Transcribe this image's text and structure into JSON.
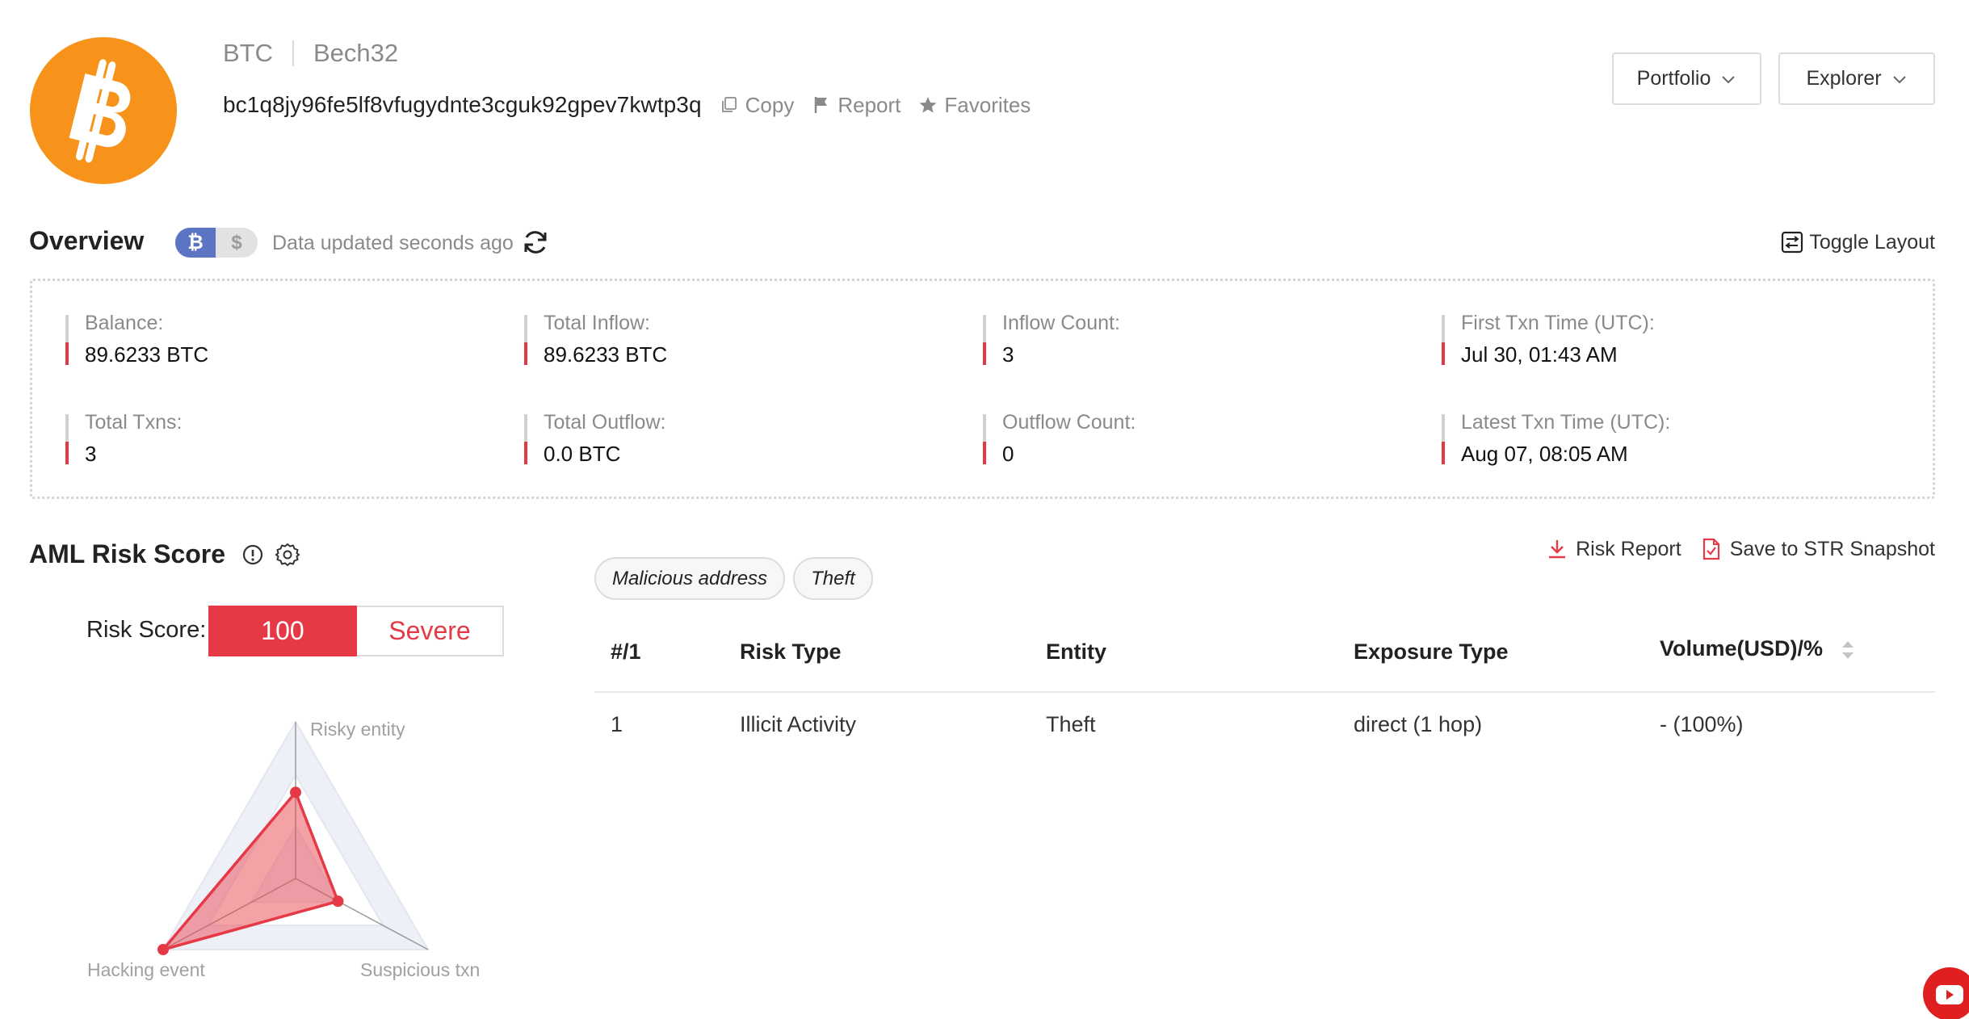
{
  "header": {
    "coin": "BTC",
    "address_type": "Bech32",
    "address": "bc1q8jy96fe5lf8vfugydnte3cguk92gpev7kwtp3q",
    "actions": {
      "copy": "Copy",
      "report": "Report",
      "favorites": "Favorites"
    },
    "buttons": {
      "portfolio": "Portfolio",
      "explorer": "Explorer"
    }
  },
  "overview": {
    "title": "Overview",
    "currency_toggle": {
      "btc": "₿",
      "usd": "$"
    },
    "updated": "Data updated seconds ago",
    "toggle_layout": "Toggle Layout",
    "stats": [
      {
        "label": "Balance:",
        "value": "89.6233 BTC"
      },
      {
        "label": "Total Inflow:",
        "value": "89.6233 BTC"
      },
      {
        "label": "Inflow Count:",
        "value": "3"
      },
      {
        "label": "First Txn Time (UTC):",
        "value": "Jul 30, 01:43 AM"
      },
      {
        "label": "Total Txns:",
        "value": "3"
      },
      {
        "label": "Total Outflow:",
        "value": "0.0 BTC"
      },
      {
        "label": "Outflow Count:",
        "value": "0"
      },
      {
        "label": "Latest Txn Time (UTC):",
        "value": "Aug 07, 08:05 AM"
      }
    ]
  },
  "aml": {
    "title": "AML Risk Score",
    "risk_score_label": "Risk Score:",
    "score": "100",
    "level": "Severe",
    "radar": {
      "axes": [
        "Risky entity",
        "Suspicious txn",
        "Hacking event"
      ],
      "values": [
        0.55,
        0.32,
        1.0
      ]
    },
    "tags": [
      "Malicious address",
      "Theft"
    ],
    "actions": {
      "risk_report": "Risk Report",
      "save_snapshot": "Save to STR Snapshot"
    },
    "table": {
      "headers": [
        "#/1",
        "Risk Type",
        "Entity",
        "Exposure Type",
        "Volume(USD)/%"
      ],
      "rows": [
        [
          "1",
          "Illicit Activity",
          "Theft",
          "direct (1 hop)",
          "- (100%)"
        ]
      ]
    }
  },
  "colors": {
    "brand": "#f7931a",
    "accent": "#5c74c4",
    "danger": "#e53946"
  }
}
